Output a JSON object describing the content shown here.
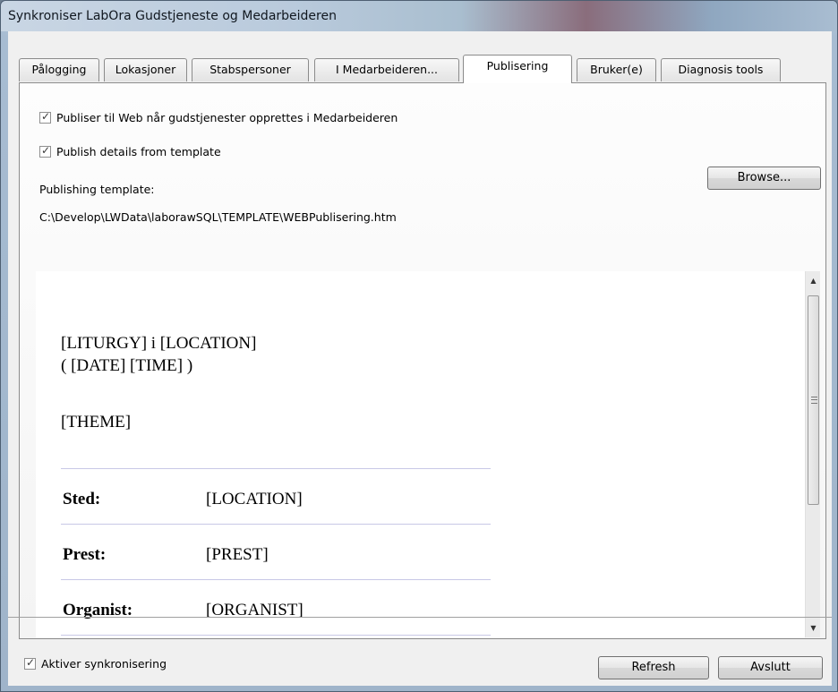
{
  "window": {
    "title": "Synkroniser LabOra Gudstjeneste og Medarbeideren"
  },
  "tabs": [
    {
      "label": "Pålogging"
    },
    {
      "label": "Lokasjoner"
    },
    {
      "label": "Stabspersoner"
    },
    {
      "label": "I Medarbeideren..."
    },
    {
      "label": "Publisering",
      "active": true
    },
    {
      "label": "Bruker(e)"
    },
    {
      "label": "Diagnosis tools"
    }
  ],
  "publishing": {
    "publish_web_label": "Publiser til Web når gudstjenester opprettes i Medarbeideren",
    "publish_web_checked": true,
    "publish_details_label": "Publish details from template",
    "publish_details_checked": true,
    "template_label": "Publishing template:",
    "template_path": "C:\\Develop\\LWData\\laborawSQL\\TEMPLATE\\WEBPublisering.htm",
    "browse_label": "Browse..."
  },
  "preview": {
    "heading_line1": "[LITURGY] i [LOCATION]",
    "heading_line2": "( [DATE] [TIME] )",
    "theme": "[THEME]",
    "rows": [
      {
        "label": "Sted:",
        "value": "[LOCATION]"
      },
      {
        "label": "Prest:",
        "value": "[PREST]"
      },
      {
        "label": "Organist:",
        "value": "[ORGANIST]"
      }
    ]
  },
  "footer": {
    "activate_label": "Aktiver synkronisering",
    "activate_checked": true,
    "refresh_label": "Refresh",
    "close_label": "Avslutt"
  }
}
